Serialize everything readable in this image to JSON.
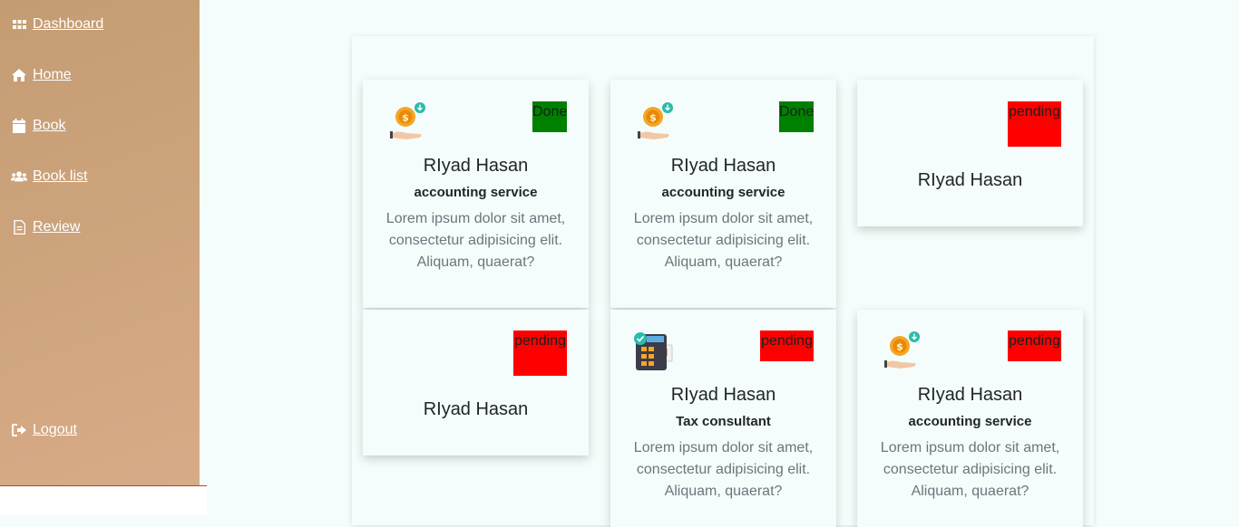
{
  "sidebar": {
    "items": [
      {
        "label": "Dashboard",
        "icon": "grid-icon"
      },
      {
        "label": "Home",
        "icon": "home-icon"
      },
      {
        "label": "Book",
        "icon": "calendar-icon"
      },
      {
        "label": "Book list",
        "icon": "users-icon"
      },
      {
        "label": "Review",
        "icon": "document-icon"
      }
    ],
    "logout": {
      "label": "Logout",
      "icon": "sign-out-icon"
    }
  },
  "cards": [
    {
      "name": "RIyad Hasan",
      "service": "accounting service",
      "description": "Lorem ipsum dolor sit amet, consectetur adipisicing elit. Aliquam, quaerat?",
      "status": "Done",
      "status_color": "#008000",
      "icon": "coin-hand-icon"
    },
    {
      "name": "RIyad Hasan",
      "service": "accounting service",
      "description": "Lorem ipsum dolor sit amet, consectetur adipisicing elit. Aliquam, quaerat?",
      "status": "Done",
      "status_color": "#008000",
      "icon": "coin-hand-icon"
    },
    {
      "name": "RIyad Hasan",
      "status": "pending",
      "status_color": "#ff0000"
    },
    {
      "name": "RIyad Hasan",
      "status": "pending",
      "status_color": "#ff0000"
    },
    {
      "name": "RIyad Hasan",
      "service": "Tax consultant",
      "description": "Lorem ipsum dolor sit amet, consectetur adipisicing elit. Aliquam, quaerat?",
      "status": "pending",
      "status_color": "#ff0000",
      "icon": "calculator-icon"
    },
    {
      "name": "RIyad Hasan",
      "service": "accounting service",
      "description": "Lorem ipsum dolor sit amet, consectetur adipisicing elit. Aliquam, quaerat?",
      "status": "pending",
      "status_color": "#ff0000",
      "icon": "coin-hand-icon"
    }
  ]
}
